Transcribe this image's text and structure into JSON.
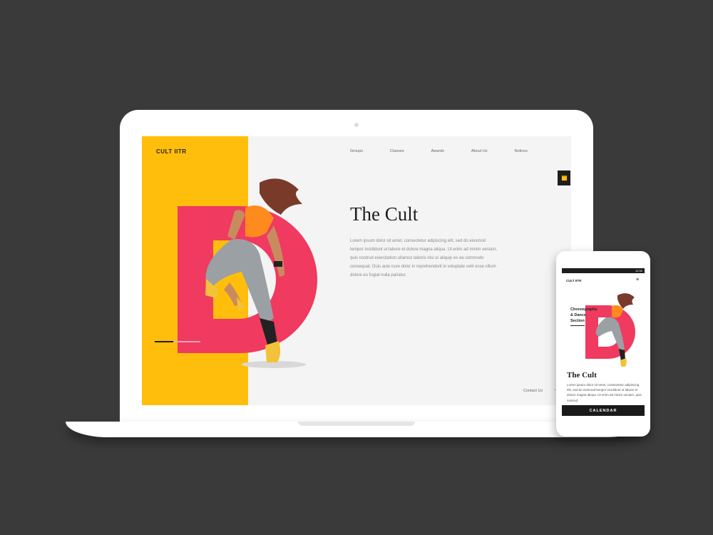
{
  "site": {
    "brand": "CULT IITR",
    "nav": [
      "Groups",
      "Classes",
      "Awards",
      "About Us",
      "Notices"
    ],
    "title": "The Cult",
    "body": "Lorem ipsum dolor sit amet, consectetur adipiscing elit, sed do eiusmod tempor incididunt ut labore et dolore magna aliqua. Ut enim ad minim veniam, quis nostrud exercitation ullamco laboris nisi ut aliquip ex ea commodo consequat. Duis aute irure dolor in reprehenderit in voluptate velit esse cillum dolore eu fugiat nulla pariatur.",
    "contact": "Contact Us",
    "contact_arrow": "→",
    "hero_letter": "D"
  },
  "mobile": {
    "time": "12:30",
    "brand": "CULT IITR",
    "section": [
      "Choreography",
      "& Dance",
      "Section"
    ],
    "title": "The Cult",
    "body": "Lorem ipsum dolor sit amet, consectetur adipiscing elit, sed do eiusmod tempor incididunt ut labore et dolore magna aliqua. Ut enim ad minim veniam, quis nostrud",
    "calendar": "CALENDAR"
  },
  "colors": {
    "background": "#3a3a3a",
    "accent_yellow": "#ffbe0b",
    "accent_red": "#f03a5f",
    "dark": "#1e1e1e"
  }
}
